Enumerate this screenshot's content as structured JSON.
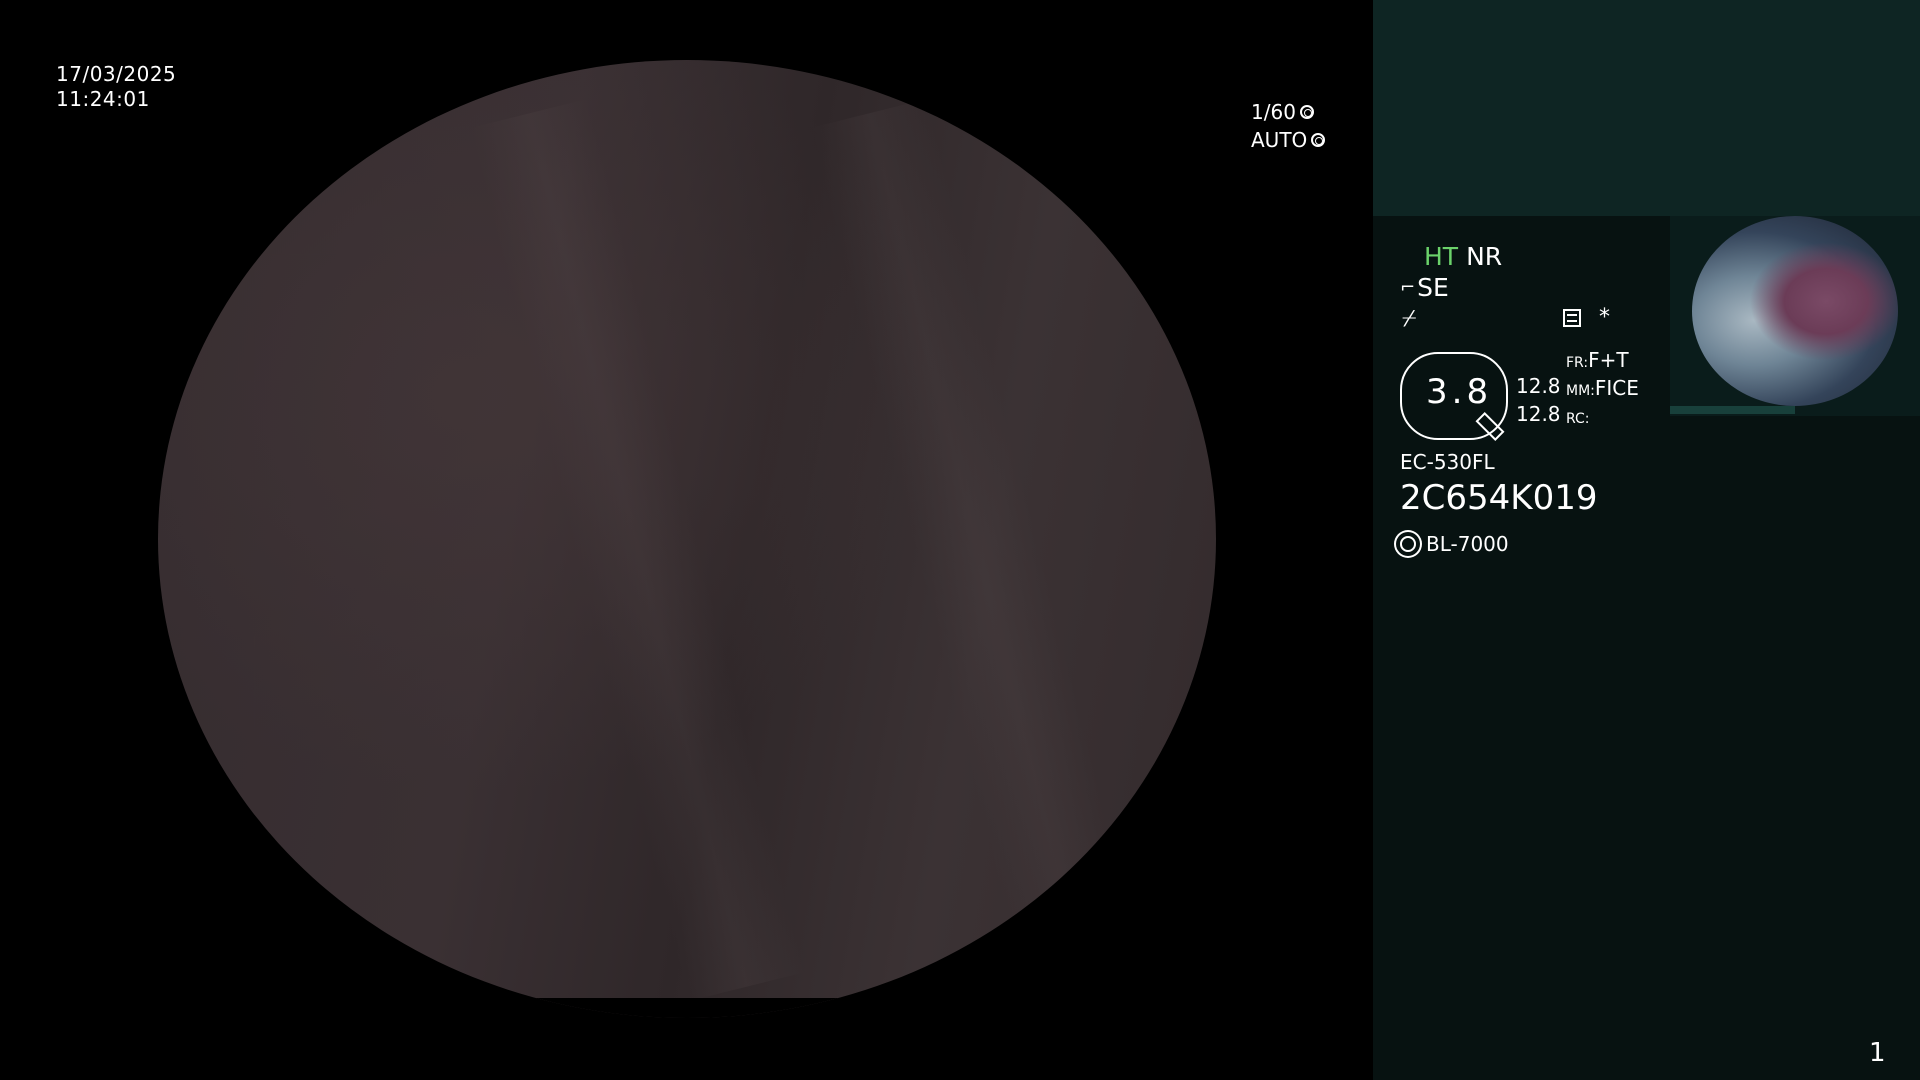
{
  "overlay": {
    "date": "17/03/2025",
    "time": "11:24:01",
    "shutter": "1/60",
    "iris": "AUTO"
  },
  "panel": {
    "mode_ht": "HT",
    "mode_nr": "NR",
    "enhance": "SE",
    "slash_symbol": "⌿",
    "asterisk": "*",
    "zoom_value": "3.8",
    "zoom_nums": [
      "12.8",
      "12.8"
    ],
    "settings": [
      {
        "key": "FR:",
        "value": "F+T"
      },
      {
        "key": "MM:",
        "value": "FICE"
      },
      {
        "key": "RC:",
        "value": ""
      }
    ],
    "scope_model": "EC-530FL",
    "scope_serial": "2C654K019",
    "light_source": "BL-7000",
    "page_number": "1"
  },
  "colors": {
    "panel_top": "#0e2523",
    "panel_bottom": "#071211",
    "ht_green": "#6bd26b"
  }
}
